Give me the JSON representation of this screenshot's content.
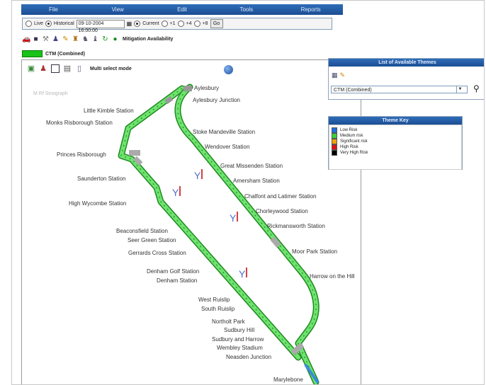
{
  "menu": [
    "File",
    "View",
    "Edit",
    "Tools",
    "Reports"
  ],
  "controls": {
    "live_label": "Live",
    "historical_label": "Historical",
    "datetime": "09-10-2004 16:00:00",
    "current_label": "Current",
    "opt_a": "+1",
    "opt_b": "+4",
    "opt_c": "+8",
    "go_label": "Go"
  },
  "toolbar": {
    "availability_label": "Mitigation Availability"
  },
  "status": {
    "label": "CTM (Combined)"
  },
  "map_tools": {
    "multi_select_label": "Multi select mode"
  },
  "watermark": "M Rf Sinograph",
  "stations": [
    {
      "name": "Aylesbury"
    },
    {
      "name": "Aylesbury Junction"
    },
    {
      "name": "Little Kimble Station"
    },
    {
      "name": "Monks Risborough Station"
    },
    {
      "name": "Stoke Mandeville Station"
    },
    {
      "name": "Wendover Station"
    },
    {
      "name": "Princes Risborough"
    },
    {
      "name": "Great Missenden Station"
    },
    {
      "name": "Saunderton Station"
    },
    {
      "name": "Amersham Station"
    },
    {
      "name": "Chalfont and Latimer Station"
    },
    {
      "name": "High Wycombe Station"
    },
    {
      "name": "Chorleywood Station"
    },
    {
      "name": "Rickmansworth Station"
    },
    {
      "name": "Beaconsfield Station"
    },
    {
      "name": "Seer Green Station"
    },
    {
      "name": "Moor Park Station"
    },
    {
      "name": "Gerrards Cross Station"
    },
    {
      "name": "Harrow on the Hill"
    },
    {
      "name": "Denham Golf Station"
    },
    {
      "name": "Denham Station"
    },
    {
      "name": "West Ruislip"
    },
    {
      "name": "South Ruislip"
    },
    {
      "name": "Northolt Park"
    },
    {
      "name": "Sudbury Hill"
    },
    {
      "name": "Sudbury and Harrow"
    },
    {
      "name": "Wembley Stadium"
    },
    {
      "name": "Neasden Junction"
    },
    {
      "name": "Marylebone"
    }
  ],
  "themes_panel": {
    "title": "List of Available Themes",
    "selected": "CTM (Combined)"
  },
  "key_panel": {
    "title": "Theme Key",
    "items": [
      {
        "label": "Low Risk",
        "color": "#1e6fe0"
      },
      {
        "label": "Medium risk",
        "color": "#3ad13a"
      },
      {
        "label": "Significant risk",
        "color": "#f0a300"
      },
      {
        "label": "High Risk",
        "color": "#e01010"
      },
      {
        "label": "Very High Risk",
        "color": "#000000"
      }
    ]
  }
}
